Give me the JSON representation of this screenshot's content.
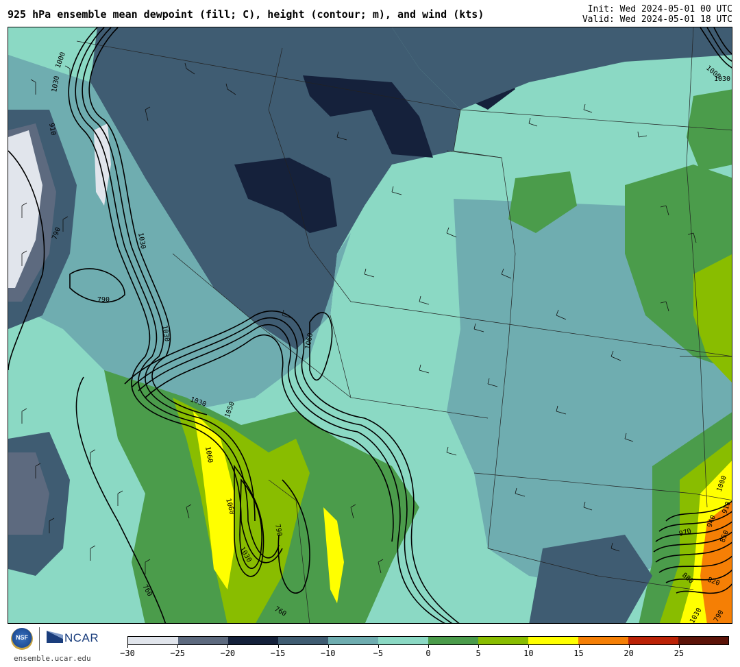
{
  "header": {
    "title": "925 hPa ensemble mean dewpoint (fill; C), height (contour; m), and wind (kts)",
    "init": "Init: Wed 2024-05-01 00 UTC",
    "valid": "Valid: Wed 2024-05-01 18 UTC"
  },
  "footer": {
    "site": "ensemble.ucar.edu",
    "nsf_label": "NSF",
    "ncar_label": "NCAR"
  },
  "colorbar": {
    "colors": [
      "#e1e5ec",
      "#5d6a7f",
      "#15213b",
      "#3f5c72",
      "#6fadb0",
      "#8bd9c4",
      "#4b9c4b",
      "#89bd00",
      "#ffff00",
      "#f57f05",
      "#bc2206",
      "#5c1308"
    ],
    "tick_labels": [
      "−30",
      "−25",
      "−20",
      "−15",
      "−10",
      "−5",
      "0",
      "5",
      "10",
      "15",
      "20",
      "25"
    ]
  },
  "contour_labels": {
    "west": [
      "790",
      "1030",
      "790",
      "1030",
      "1000",
      "910",
      "1030"
    ],
    "central": [
      "1030",
      "1060",
      "1060",
      "1030",
      "1050",
      "790",
      "760",
      "760",
      "1060"
    ],
    "east": [
      "1000",
      "910",
      "940",
      "850",
      "970",
      "820",
      "880",
      "1030",
      "790",
      "1030",
      "1000"
    ]
  }
}
